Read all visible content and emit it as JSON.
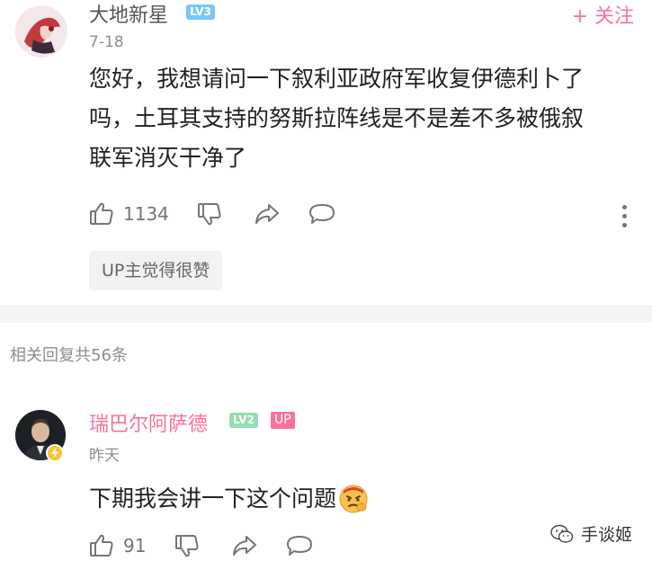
{
  "comment": {
    "username": "大地新星",
    "level": "LV3",
    "date": "7-18",
    "follow_label": "+ 关注",
    "text_lines": [
      "您好，我想请问一下叙利亚政府军收复伊德利卜了",
      "吗，土耳其支持的努斯拉阵线是不是差不多被俄叙",
      "联军消灭干净了"
    ],
    "likes": "1134",
    "up_tag": "UP主觉得很赞"
  },
  "replies_header": "相关回复共56条",
  "reply": {
    "username": "瑞巴尔阿萨德",
    "level": "LV2",
    "badge": "UP",
    "date": "昨天",
    "text": "下期我会讲一下这个问题",
    "likes": "91"
  },
  "watermark": "手谈姬",
  "colors": {
    "accent": "#fb7299",
    "lv3": "#7bc7f2",
    "lv2": "#95ddb2",
    "text": "#212121",
    "muted": "#8e8e8e"
  },
  "icons": [
    "thumbs-up-icon",
    "thumbs-down-icon",
    "share-icon",
    "comment-bubble-icon",
    "more-vertical-icon",
    "lightning-badge-icon",
    "emoji-icon",
    "wechat-icon"
  ]
}
